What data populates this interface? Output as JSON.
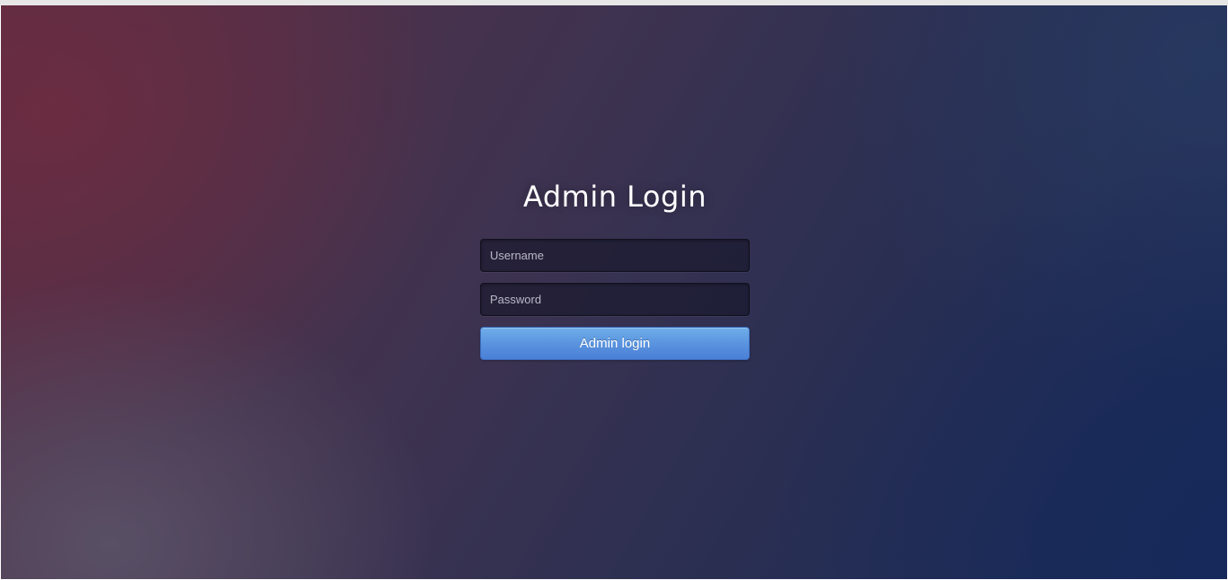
{
  "login": {
    "title": "Admin Login",
    "username_placeholder": "Username",
    "password_placeholder": "Password",
    "submit_label": "Admin login"
  }
}
